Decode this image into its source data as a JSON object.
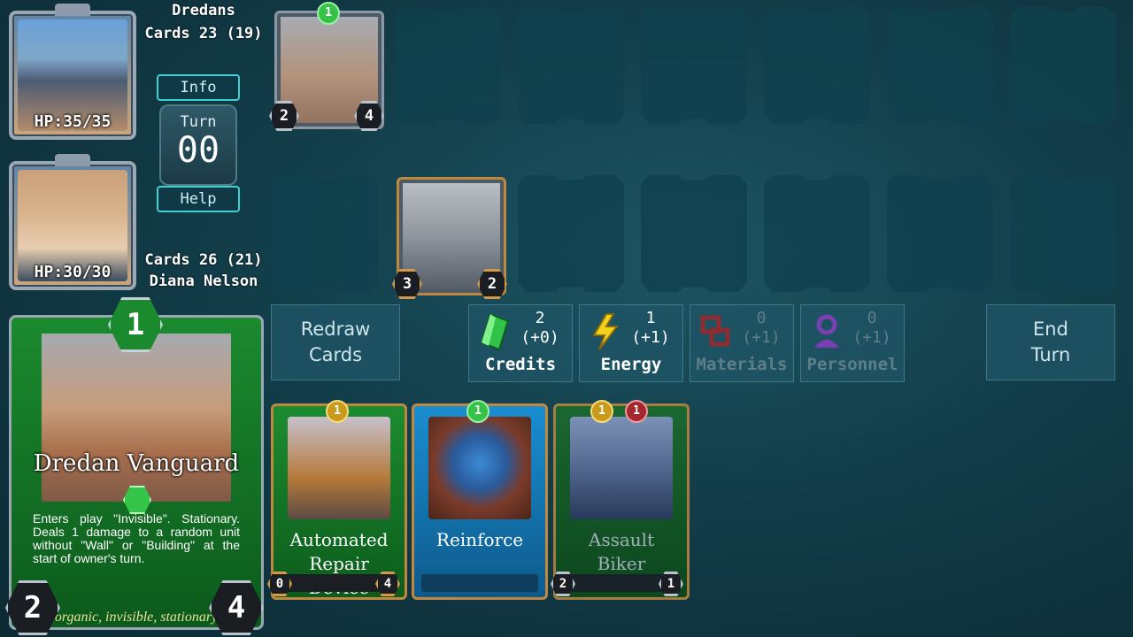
{
  "opponent": {
    "name": "Dredans",
    "cards": "Cards 23 (19)",
    "hp": "HP:35/35"
  },
  "player": {
    "name": "Diana Nelson",
    "cards": "Cards 26 (21)",
    "hp": "HP:30/30"
  },
  "info_label": "Info",
  "help_label": "Help",
  "turn": {
    "label": "Turn",
    "value": "00"
  },
  "enemy_unit": {
    "cost": "1",
    "attack": "2",
    "health": "4"
  },
  "player_unit": {
    "attack": "3",
    "health": "2"
  },
  "selected_card": {
    "cost": "1",
    "name": "Dredan Vanguard",
    "description": "Enters play \"Invisible\". Stationary. Deals 1 damage to a random unit without \"Wall\" or \"Building\" at the start of owner's turn.",
    "tags": "organic, invisible, stationary",
    "attack": "2",
    "health": "4"
  },
  "redraw_button": "Redraw Cards",
  "end_turn_button": "End Turn",
  "resources": [
    {
      "name": "Credits",
      "count": "2",
      "delta": "(+0)",
      "icon": "green-crystal-icon",
      "color": "#31c24a",
      "dim": false
    },
    {
      "name": "Energy",
      "count": "1",
      "delta": "(+1)",
      "icon": "lightning-icon",
      "color": "#f2d21c",
      "dim": false
    },
    {
      "name": "Materials",
      "count": "0",
      "delta": "(+1)",
      "icon": "materials-icon",
      "color": "#8a2e34",
      "dim": true
    },
    {
      "name": "Personnel",
      "count": "0",
      "delta": "(+1)",
      "icon": "personnel-icon",
      "color": "#7b3fb4",
      "dim": true
    }
  ],
  "hand": [
    {
      "name": "Automated Repair Device",
      "cost": "1",
      "cost2": "",
      "left": "0",
      "right": "4"
    },
    {
      "name": "Reinforce",
      "cost": "1",
      "cost2": "",
      "left": "",
      "right": ""
    },
    {
      "name": "Assault Biker",
      "cost": "1",
      "cost2": "1",
      "left": "2",
      "right": "1"
    }
  ]
}
